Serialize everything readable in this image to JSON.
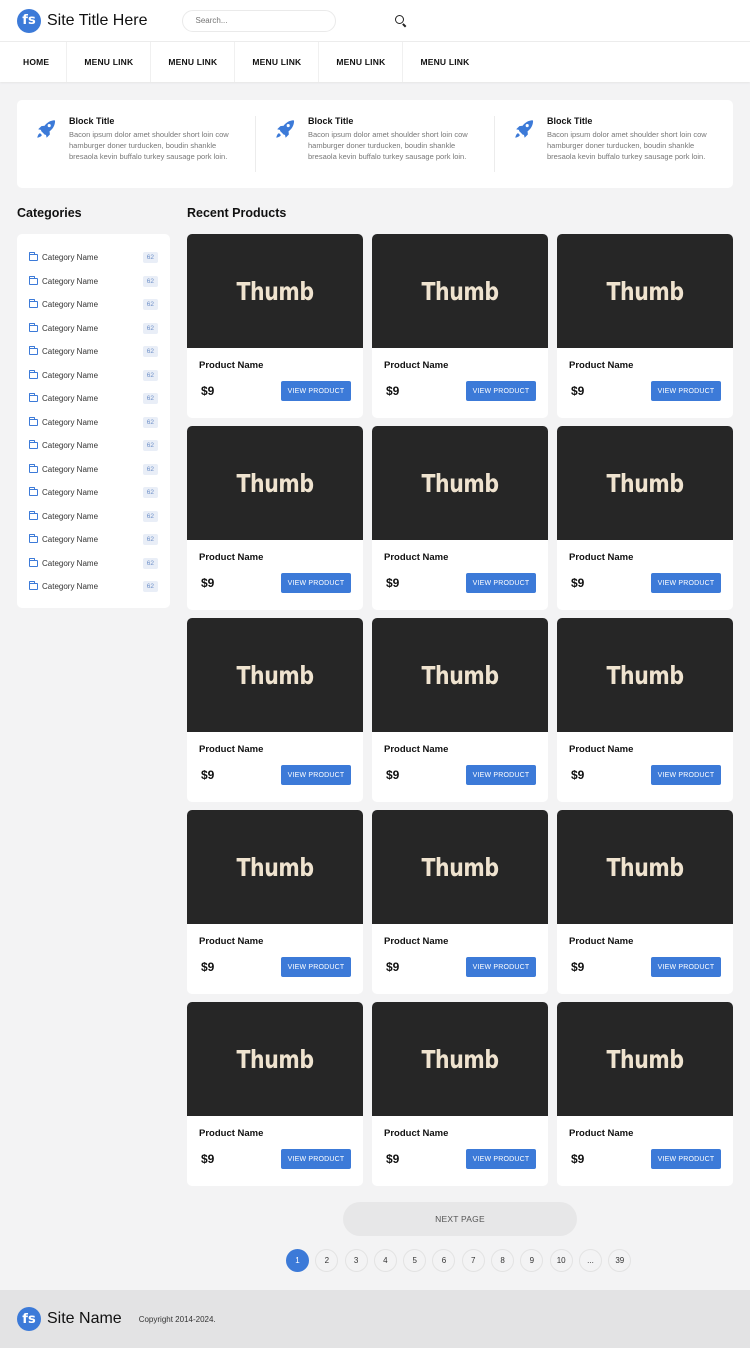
{
  "header": {
    "logo_text": "fs",
    "site_title": "Site Title Here",
    "search_placeholder": "Search..."
  },
  "nav": {
    "items": [
      "HOME",
      "MENU LINK",
      "MENU LINK",
      "MENU LINK",
      "MENU LINK",
      "MENU LINK"
    ]
  },
  "features": [
    {
      "title": "Block Title",
      "desc": "Bacon ipsum dolor amet shoulder short loin cow hamburger doner turducken, boudin shankle bresaola kevin buffalo turkey sausage pork loin."
    },
    {
      "title": "Block Title",
      "desc": "Bacon ipsum dolor amet shoulder short loin cow hamburger doner turducken, boudin shankle bresaola kevin buffalo turkey sausage pork loin."
    },
    {
      "title": "Block Title",
      "desc": "Bacon ipsum dolor amet shoulder short loin cow hamburger doner turducken, boudin shankle bresaola kevin buffalo turkey sausage pork loin."
    }
  ],
  "sidebar": {
    "title": "Categories",
    "items": [
      {
        "name": "Category Name",
        "count": "62"
      },
      {
        "name": "Category Name",
        "count": "62"
      },
      {
        "name": "Category Name",
        "count": "62"
      },
      {
        "name": "Category Name",
        "count": "62"
      },
      {
        "name": "Category Name",
        "count": "62"
      },
      {
        "name": "Category Name",
        "count": "62"
      },
      {
        "name": "Category Name",
        "count": "62"
      },
      {
        "name": "Category Name",
        "count": "62"
      },
      {
        "name": "Category Name",
        "count": "62"
      },
      {
        "name": "Category Name",
        "count": "62"
      },
      {
        "name": "Category Name",
        "count": "62"
      },
      {
        "name": "Category Name",
        "count": "62"
      },
      {
        "name": "Category Name",
        "count": "62"
      },
      {
        "name": "Category Name",
        "count": "62"
      },
      {
        "name": "Category Name",
        "count": "62"
      }
    ]
  },
  "products": {
    "title": "Recent Products",
    "button_label": "VIEW PRODUCT",
    "items": [
      {
        "thumb": "Thumb",
        "name": "Product Name",
        "price": "$9"
      },
      {
        "thumb": "Thumb",
        "name": "Product Name",
        "price": "$9"
      },
      {
        "thumb": "Thumb",
        "name": "Product Name",
        "price": "$9"
      },
      {
        "thumb": "Thumb",
        "name": "Product Name",
        "price": "$9"
      },
      {
        "thumb": "Thumb",
        "name": "Product Name",
        "price": "$9"
      },
      {
        "thumb": "Thumb",
        "name": "Product Name",
        "price": "$9"
      },
      {
        "thumb": "Thumb",
        "name": "Product Name",
        "price": "$9"
      },
      {
        "thumb": "Thumb",
        "name": "Product Name",
        "price": "$9"
      },
      {
        "thumb": "Thumb",
        "name": "Product Name",
        "price": "$9"
      },
      {
        "thumb": "Thumb",
        "name": "Product Name",
        "price": "$9"
      },
      {
        "thumb": "Thumb",
        "name": "Product Name",
        "price": "$9"
      },
      {
        "thumb": "Thumb",
        "name": "Product Name",
        "price": "$9"
      },
      {
        "thumb": "Thumb",
        "name": "Product Name",
        "price": "$9"
      },
      {
        "thumb": "Thumb",
        "name": "Product Name",
        "price": "$9"
      },
      {
        "thumb": "Thumb",
        "name": "Product Name",
        "price": "$9"
      }
    ]
  },
  "pagination": {
    "next_label": "NEXT PAGE",
    "pages": [
      "1",
      "2",
      "3",
      "4",
      "5",
      "6",
      "7",
      "8",
      "9",
      "10",
      "...",
      "39"
    ],
    "active": "1"
  },
  "footer": {
    "logo_text": "fs",
    "site_name": "Site Name",
    "copyright": "Copyright 2014-2024."
  },
  "colors": {
    "accent": "#3c7ad8",
    "background": "#f3f3f4",
    "thumb_bg": "#262626",
    "thumb_text": "#efe3cf"
  },
  "icons": {
    "feature": "rocket-icon",
    "search": "search-icon",
    "category": "folder-icon"
  }
}
